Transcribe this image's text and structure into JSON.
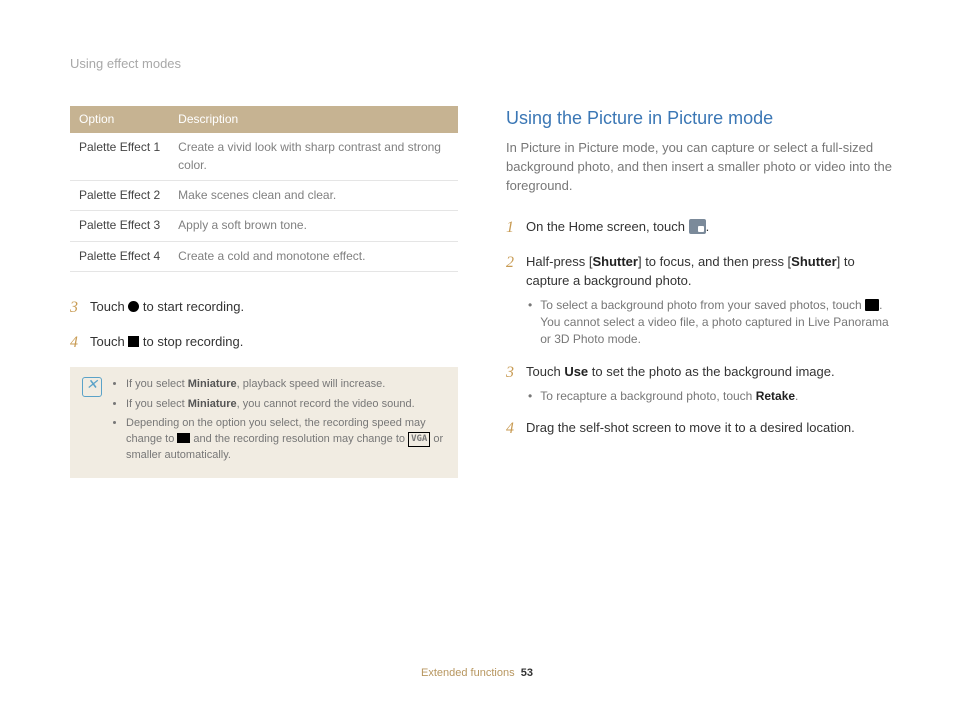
{
  "header": "Using effect modes",
  "table": {
    "head": {
      "option": "Option",
      "desc": "Description"
    },
    "rows": [
      {
        "option": "Palette Effect 1",
        "desc": "Create a vivid look with sharp contrast and strong color."
      },
      {
        "option": "Palette Effect 2",
        "desc": "Make scenes clean and clear."
      },
      {
        "option": "Palette Effect 3",
        "desc": "Apply a soft brown tone."
      },
      {
        "option": "Palette Effect 4",
        "desc": "Create a cold and monotone effect."
      }
    ]
  },
  "left_steps": {
    "s3": {
      "pre": "Touch ",
      "post": " to start recording."
    },
    "s4": {
      "pre": "Touch ",
      "post": " to stop recording."
    }
  },
  "note": {
    "l1": {
      "a": "If you select ",
      "b": "Miniature",
      "c": ", playback speed will increase."
    },
    "l2": {
      "a": "If you select ",
      "b": "Miniature",
      "c": ", you cannot record the video sound."
    },
    "l3": {
      "a": "Depending on the option you select, the recording speed may change to ",
      "b": " and the recording resolution may change to ",
      "c": " or smaller automatically."
    }
  },
  "right": {
    "title": "Using the Picture in Picture mode",
    "intro": "In Picture in Picture mode, you can capture or select a full-sized background photo, and then insert a smaller photo or video into the foreground.",
    "s1": {
      "a": "On the Home screen, touch ",
      "b": "."
    },
    "s2": {
      "a": "Half-press [",
      "b": "Shutter",
      "c": "] to focus, and then press [",
      "d": "Shutter",
      "e": "] to capture a background photo."
    },
    "s2_sub": {
      "a": "To select a background photo from your saved photos, touch ",
      "b": ". You cannot select a video file, a photo captured in Live Panorama or 3D Photo mode."
    },
    "s3": {
      "a": "Touch ",
      "b": "Use",
      "c": " to set the photo as the background image."
    },
    "s3_sub": {
      "a": "To recapture a background photo, touch ",
      "b": "Retake",
      "c": "."
    },
    "s4": "Drag the self-shot screen to move it to a desired location."
  },
  "footer": {
    "section": "Extended functions",
    "page": "53"
  },
  "vga": "VGA"
}
